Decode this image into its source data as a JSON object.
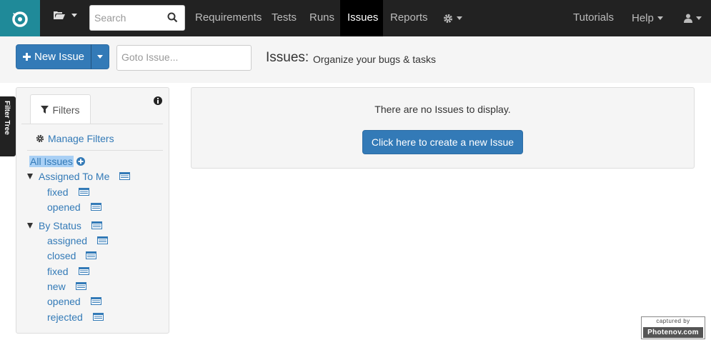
{
  "topnav": {
    "search_placeholder": "Search",
    "links": [
      "Requirements",
      "Tests",
      "Runs",
      "Issues",
      "Reports"
    ],
    "active": "Issues",
    "right_links": [
      "Tutorials",
      "Help"
    ]
  },
  "toolbar": {
    "new_issue_label": "New Issue",
    "goto_placeholder": "Goto Issue...",
    "page_title": "Issues:",
    "page_subtitle": "Organize your bugs & tasks"
  },
  "sidebar": {
    "filter_tree_tab": "Filter Tree",
    "filters_tab": "Filters",
    "manage_filters": "Manage Filters",
    "all_issues": "All Issues",
    "groups": [
      {
        "label": "Assigned To Me",
        "items": [
          "fixed",
          "opened"
        ]
      },
      {
        "label": "By Status",
        "items": [
          "assigned",
          "closed",
          "fixed",
          "new",
          "opened",
          "rejected"
        ]
      }
    ]
  },
  "main": {
    "empty_message": "There are no Issues to display.",
    "create_button": "Click here to create a new Issue"
  },
  "watermark": {
    "line1": "captured by",
    "line2": "Photenov.com"
  },
  "colors": {
    "nav_bg": "#222222",
    "logo_bg": "#1f8a99",
    "primary": "#337ab7",
    "link": "#337ab7",
    "selected_bg": "#a9d0f5"
  }
}
